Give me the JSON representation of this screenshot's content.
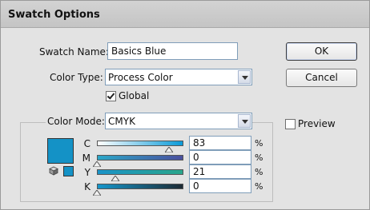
{
  "dialog": {
    "title": "Swatch Options"
  },
  "form": {
    "swatch_name_label": "Swatch Name:",
    "swatch_name_value": "Basics Blue",
    "color_type_label": "Color Type:",
    "color_type_value": "Process Color",
    "global_label": "Global",
    "global_checked": true,
    "color_mode_label": "Color Mode:",
    "color_mode_value": "CMYK"
  },
  "buttons": {
    "ok": "OK",
    "cancel": "Cancel"
  },
  "preview": {
    "label": "Preview",
    "checked": false
  },
  "swatch_color": "#1492c6",
  "channels": [
    {
      "label": "C",
      "value": "83",
      "unit": "%",
      "level": 0.83
    },
    {
      "label": "M",
      "value": "0",
      "unit": "%",
      "level": 0.0
    },
    {
      "label": "Y",
      "value": "21",
      "unit": "%",
      "level": 0.21
    },
    {
      "label": "K",
      "value": "0",
      "unit": "%",
      "level": 0.0
    }
  ],
  "icons": {
    "dropdown": "chevron-down-icon",
    "checkbox": "checkmark-icon",
    "gamut": "cube-icon",
    "slider": "triangle-marker-icon"
  }
}
